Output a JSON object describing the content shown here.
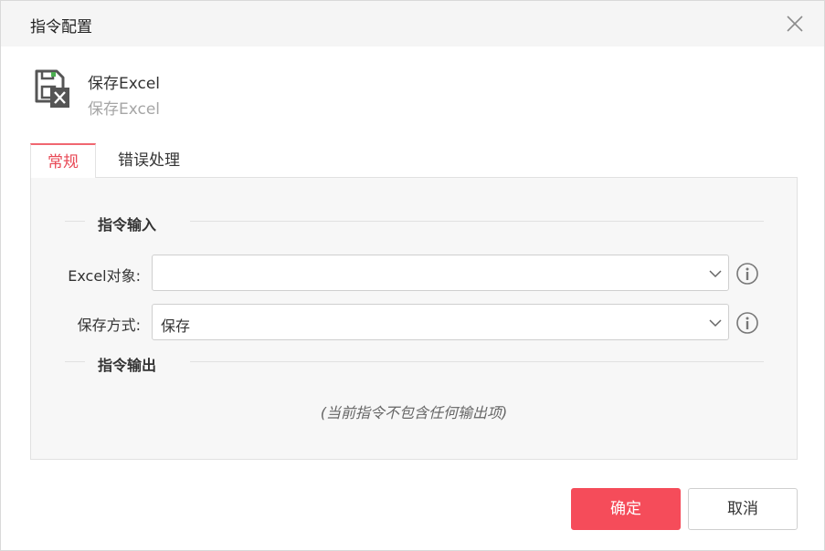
{
  "dialog": {
    "title": "指令配置"
  },
  "command": {
    "name": "保存Excel",
    "description": "保存Excel",
    "icon": "save-excel-icon"
  },
  "tabs": [
    {
      "label": "常规",
      "active": true
    },
    {
      "label": "错误处理",
      "active": false
    }
  ],
  "sections": {
    "input": {
      "title": "指令输入"
    },
    "output": {
      "title": "指令输出",
      "empty_note": "(当前指令不包含任何输出项)"
    }
  },
  "fields": [
    {
      "label": "Excel对象:",
      "value": "",
      "icon": "info-icon"
    },
    {
      "label": "保存方式:",
      "value": "保存",
      "icon": "info-icon"
    }
  ],
  "buttons": {
    "confirm": "确定",
    "cancel": "取消"
  },
  "colors": {
    "accent": "#f54c5a",
    "active_tab": "#e84855"
  }
}
